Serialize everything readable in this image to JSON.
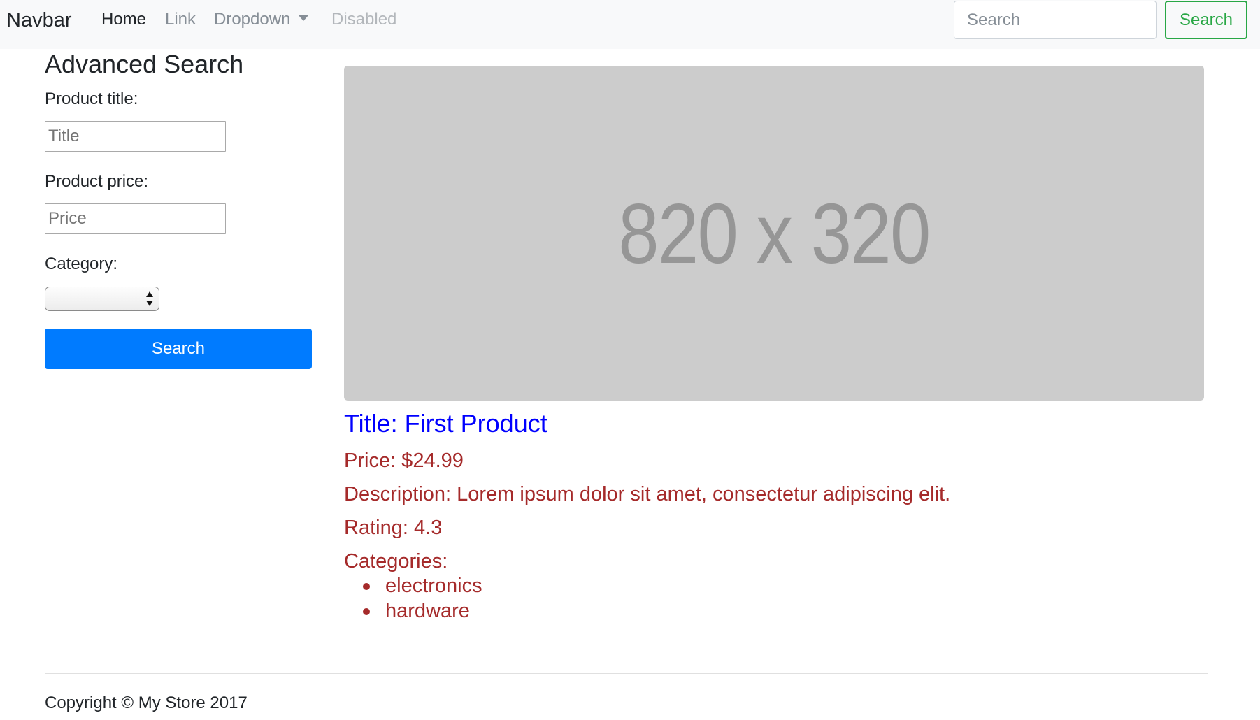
{
  "navbar": {
    "brand": "Navbar",
    "links": [
      "Home",
      "Link",
      "Dropdown",
      "Disabled"
    ],
    "search_placeholder": "Search",
    "search_button": "Search"
  },
  "sidebar": {
    "title": "Advanced Search",
    "product_title_label": "Product title:",
    "product_title_placeholder": "Title",
    "product_price_label": "Product price:",
    "product_price_placeholder": "Price",
    "category_label": "Category:",
    "category_selected": "",
    "search_button": "Search"
  },
  "product": {
    "image_placeholder": "820 x 320",
    "title": "Title: First Product",
    "price": "Price: $24.99",
    "description": "Description: Lorem ipsum dolor sit amet, consectetur adipiscing elit.",
    "rating": "Rating: 4.3",
    "categories_label": "Categories:",
    "categories": [
      "electronics",
      "hardware"
    ]
  },
  "footer": {
    "copyright": "Copyright © My Store 2017"
  },
  "colors": {
    "primary": "#007bff",
    "success": "#28a745",
    "title_blue": "#0000ff",
    "detail_brown": "#a52a2a",
    "navbar_bg": "#f8f9fa"
  }
}
